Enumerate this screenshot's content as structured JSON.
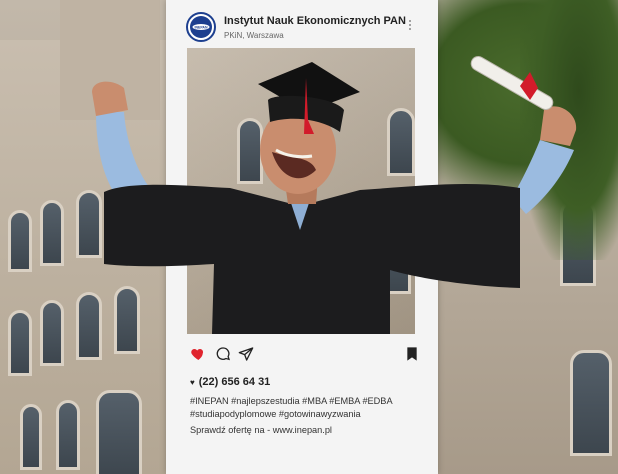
{
  "post": {
    "account_name": "Instytut Nauk Ekonomicznych PAN",
    "account_subtitle": "PKiN, Warszawa",
    "avatar_logo_text": "INEPAN",
    "phone": "(22) 656 64 31",
    "hashtags_line1": "#INEPAN #najlepszestudia #MBA #EMBA #EDBA",
    "hashtags_line2": "#studiapodyplomowe #gotowinawyzwania",
    "cta": "Sprawdź ofertę na - www.inepan.pl"
  },
  "icons": {
    "more": "more-vertical-icon",
    "heart": "heart-icon",
    "comment": "comment-icon",
    "share": "share-icon",
    "bookmark": "bookmark-icon"
  },
  "colors": {
    "heart": "#e0242e",
    "brand_blue": "#1d3f8f",
    "ribbon": "#d21b2a"
  }
}
